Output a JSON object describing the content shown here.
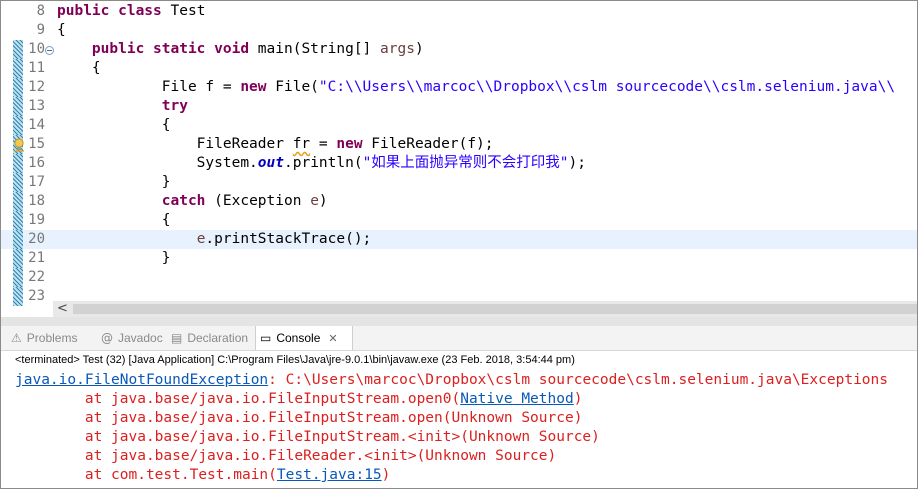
{
  "editor": {
    "lines": [
      {
        "num": "8",
        "segments": [
          {
            "t": "public class ",
            "c": "kw"
          },
          {
            "t": "Test",
            "c": ""
          }
        ]
      },
      {
        "num": "9",
        "segments": [
          {
            "t": "{",
            "c": ""
          }
        ]
      },
      {
        "num": "10",
        "segments": [
          {
            "t": "    ",
            "c": ""
          },
          {
            "t": "public static void ",
            "c": "kw"
          },
          {
            "t": "main(String[] ",
            "c": ""
          },
          {
            "t": "args",
            "c": "var"
          },
          {
            "t": ")",
            "c": ""
          }
        ]
      },
      {
        "num": "11",
        "segments": [
          {
            "t": "    {",
            "c": ""
          }
        ]
      },
      {
        "num": "12",
        "segments": [
          {
            "t": "            File f = ",
            "c": ""
          },
          {
            "t": "new ",
            "c": "kw"
          },
          {
            "t": "File(",
            "c": ""
          },
          {
            "t": "\"C:\\\\Users\\\\marcoc\\\\Dropbox\\\\cslm sourcecode\\\\cslm.selenium.java\\\\",
            "c": "str"
          }
        ]
      },
      {
        "num": "13",
        "segments": [
          {
            "t": "            ",
            "c": ""
          },
          {
            "t": "try",
            "c": "kw"
          }
        ]
      },
      {
        "num": "14",
        "segments": [
          {
            "t": "            {",
            "c": ""
          }
        ]
      },
      {
        "num": "15",
        "segments": [
          {
            "t": "                FileReader ",
            "c": ""
          },
          {
            "t": "fr",
            "c": "squig"
          },
          {
            "t": " = ",
            "c": ""
          },
          {
            "t": "new ",
            "c": "kw"
          },
          {
            "t": "FileReader(f);",
            "c": ""
          }
        ]
      },
      {
        "num": "16",
        "segments": [
          {
            "t": "                System.",
            "c": ""
          },
          {
            "t": "out",
            "c": "sf"
          },
          {
            "t": ".println(",
            "c": ""
          },
          {
            "t": "\"如果上面抛异常则不会打印我\"",
            "c": "str"
          },
          {
            "t": ");",
            "c": ""
          }
        ]
      },
      {
        "num": "17",
        "segments": [
          {
            "t": "            }",
            "c": ""
          }
        ]
      },
      {
        "num": "18",
        "segments": [
          {
            "t": "            ",
            "c": ""
          },
          {
            "t": "catch ",
            "c": "kw"
          },
          {
            "t": "(Exception ",
            "c": ""
          },
          {
            "t": "e",
            "c": "var"
          },
          {
            "t": ")",
            "c": ""
          }
        ]
      },
      {
        "num": "19",
        "segments": [
          {
            "t": "            {",
            "c": ""
          }
        ]
      },
      {
        "num": "20",
        "segments": [
          {
            "t": "                ",
            "c": ""
          },
          {
            "t": "e",
            "c": "var"
          },
          {
            "t": ".printStackTrace();",
            "c": ""
          }
        ]
      },
      {
        "num": "21",
        "segments": [
          {
            "t": "            }",
            "c": ""
          }
        ]
      },
      {
        "num": "22",
        "segments": []
      },
      {
        "num": "23",
        "segments": []
      }
    ],
    "current_line": "20",
    "fold_line": "10",
    "warning_line": "15",
    "scroll_left_icon": "chevron-left-icon"
  },
  "tabs": [
    {
      "label": "Problems",
      "icon": "problems-icon",
      "glyph": "⚠"
    },
    {
      "label": "Javadoc",
      "icon": "javadoc-icon",
      "glyph": "@"
    },
    {
      "label": "Declaration",
      "icon": "declaration-icon",
      "glyph": "▤"
    },
    {
      "label": "Console",
      "icon": "console-icon",
      "glyph": "▭",
      "active": true,
      "close": "✕"
    }
  ],
  "console": {
    "status": "<terminated> Test (32) [Java Application] C:\\Program Files\\Java\\jre-9.0.1\\bin\\javaw.exe (23 Feb. 2018, 3:54:44 pm)",
    "lines": [
      [
        {
          "t": "java.io.FileNotFoundException",
          "link": true
        },
        {
          "t": ": C:\\Users\\marcoc\\Dropbox\\cslm sourcecode\\cslm.selenium.java\\Exceptions",
          "link": false
        }
      ],
      [
        {
          "t": "        at java.base/java.io.FileInputStream.open0(",
          "link": false
        },
        {
          "t": "Native Method",
          "link": true
        },
        {
          "t": ")",
          "link": false
        }
      ],
      [
        {
          "t": "        at java.base/java.io.FileInputStream.open(Unknown Source)",
          "link": false
        }
      ],
      [
        {
          "t": "        at java.base/java.io.FileInputStream.<init>(Unknown Source)",
          "link": false
        }
      ],
      [
        {
          "t": "        at java.base/java.io.FileReader.<init>(Unknown Source)",
          "link": false
        }
      ],
      [
        {
          "t": "        at com.test.Test.main(",
          "link": false
        },
        {
          "t": "Test.java:15",
          "link": true
        },
        {
          "t": ")",
          "link": false
        }
      ]
    ]
  },
  "colors": {
    "keyword": "#7f0055",
    "string": "#2a00ff",
    "error": "#dc1f1f",
    "link": "#0a59b8",
    "current_line": "#e8f2fe"
  }
}
